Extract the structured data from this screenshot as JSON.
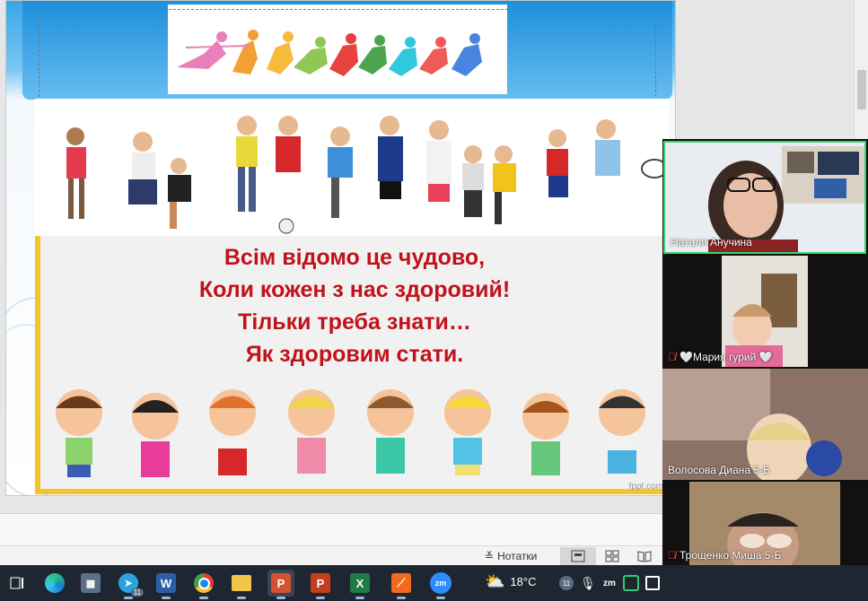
{
  "slide": {
    "lines": [
      "Всім відомо це чудово,",
      "Коли кожен з нас здоровий!",
      "Тільки треба знати…",
      "Як здоровим стати."
    ],
    "watermark": "fppt.com"
  },
  "status_bar": {
    "notes_label": "Нотатки"
  },
  "participants": [
    {
      "name": "Наталя Анучина",
      "muted": false
    },
    {
      "name": "🤍Мария гурий 🤍",
      "muted": true
    },
    {
      "name": "Волосова Диана 5-Б",
      "muted": false
    },
    {
      "name": "Трощенко Миша 5-Б",
      "muted": true
    }
  ],
  "taskbar": {
    "weather_temp": "18°C",
    "telegram_badge": "11",
    "tray_badge": "11"
  },
  "colors": {
    "accent_text": "#c0121a",
    "frame_yellow": "#f3c430",
    "active_speaker": "#3ad56a",
    "taskbar": "#1d2631"
  }
}
